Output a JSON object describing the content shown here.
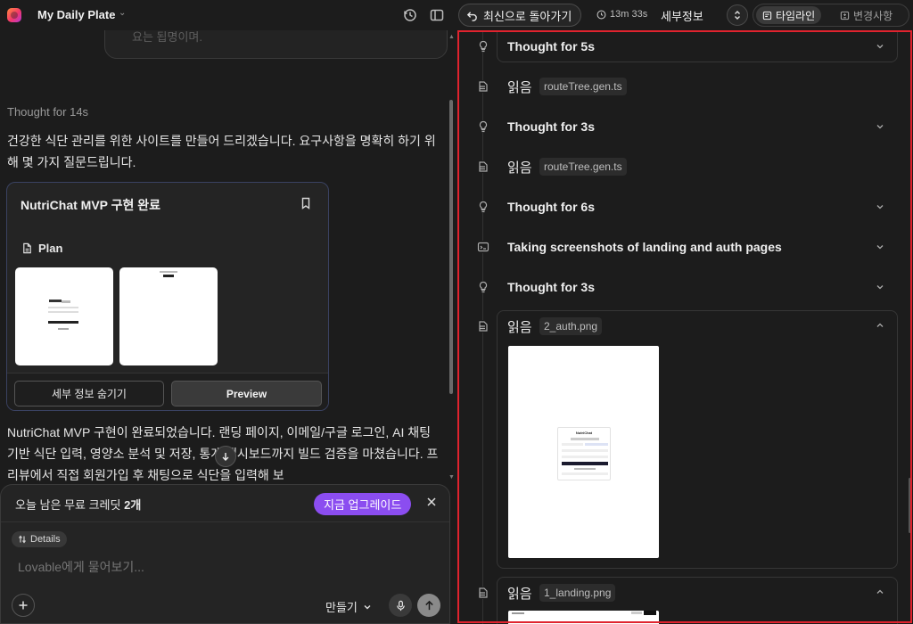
{
  "app": {
    "project_name": "My Daily Plate",
    "brand_colors": {
      "gradient_start": "#ff8a3d",
      "gradient_mid": "#f4376b",
      "gradient_end": "#b339d6"
    }
  },
  "header": {
    "history_icon": "history-icon",
    "sidebar_icon": "sidebar-toggle-icon",
    "restore_label": "최신으로 돌아가기",
    "duration": "13m 33s",
    "details_title": "세부정보",
    "tabs": [
      {
        "label": "타임라인",
        "icon": "timeline-icon",
        "active": true
      },
      {
        "label": "변경사항",
        "icon": "diff-icon",
        "active": false
      }
    ]
  },
  "chat": {
    "previous_message_fragment": "요는 됩명이며.",
    "thought_line": "Thought for 14s",
    "intro": "건강한 식단 관리를 위한 사이트를 만들어 드리겠습니다. 요구사항을 명확히 하기 위해 몇 가지 질문드립니다.",
    "plan_card": {
      "title": "NutriChat MVP 구현 완료",
      "section_label": "Plan",
      "hide_details_label": "세부 정보 숨기기",
      "preview_label": "Preview"
    },
    "summary": "NutriChat MVP 구현이 완료되었습니다. 랜딩 페이지, 이메일/구글 로그인, AI 채팅 기반 식단 입력, 영양소 분석 및 저장, 통계 대시보드까지 빌드 검증을 마쳤습니다. 프리뷰에서 직접 회원가입 후 채팅으로 식단을 입력해 보"
  },
  "composer": {
    "credit_text_prefix": "오늘 남은 무료 크레딧 ",
    "credit_count": "2개",
    "upgrade_label": "지금 업그레이드",
    "details_chip": "Details",
    "placeholder": "Lovable에게 물어보기...",
    "mode_label": "만들기",
    "accent_color": "#8b4df0"
  },
  "timeline": {
    "items": [
      {
        "kind": "thought",
        "label": "Thought for 5s",
        "icon": "lightbulb-icon",
        "expanded": false
      },
      {
        "kind": "read",
        "label": "읽음",
        "file": "routeTree.gen.ts",
        "icon": "file-read-icon"
      },
      {
        "kind": "thought",
        "label": "Thought for 3s",
        "icon": "lightbulb-icon",
        "expanded": false
      },
      {
        "kind": "read",
        "label": "읽음",
        "file": "routeTree.gen.ts",
        "icon": "file-read-icon"
      },
      {
        "kind": "thought",
        "label": "Thought for 6s",
        "icon": "lightbulb-icon",
        "expanded": false
      },
      {
        "kind": "action",
        "label": "Taking screenshots of landing and auth pages",
        "icon": "terminal-icon",
        "expanded": false
      },
      {
        "kind": "thought",
        "label": "Thought for 3s",
        "icon": "lightbulb-icon",
        "expanded": false
      },
      {
        "kind": "read",
        "label": "읽음",
        "file": "2_auth.png",
        "icon": "file-read-icon",
        "expanded": true
      },
      {
        "kind": "read",
        "label": "읽음",
        "file": "1_landing.png",
        "icon": "file-read-icon",
        "expanded": true
      }
    ],
    "auth_preview": {
      "brand": "NutriChat"
    }
  }
}
